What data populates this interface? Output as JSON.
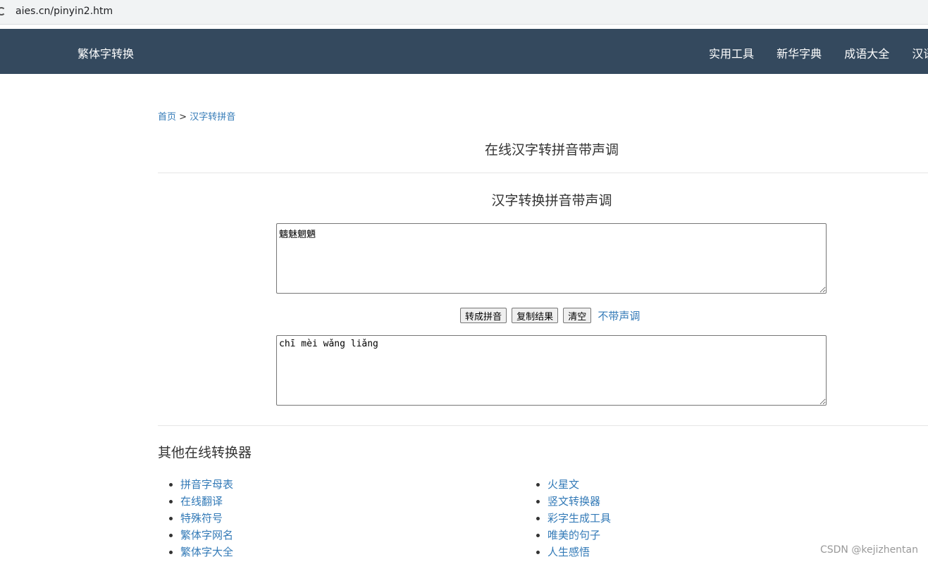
{
  "browser": {
    "url": "aies.cn/pinyin2.htm"
  },
  "navbar": {
    "brand": "繁体字转换",
    "links": [
      "实用工具",
      "新华字典",
      "成语大全",
      "汉语"
    ]
  },
  "breadcrumb": {
    "home": "首页",
    "separator": ">",
    "current": "汉字转拼音"
  },
  "page_title": "在线汉字转拼音带声调",
  "section_title": "汉字转换拼音带声调",
  "input": {
    "value": "魑魅魍魉"
  },
  "buttons": {
    "convert": "转成拼音",
    "copy": "复制结果",
    "clear": "清空"
  },
  "tone_link": "不带声调",
  "output": {
    "value": "chī mèi wǎng liǎng"
  },
  "other": {
    "title": "其他在线转换器",
    "left": [
      "拼音字母表",
      "在线翻译",
      "特殊符号",
      "繁体字网名",
      "繁体字大全"
    ],
    "right": [
      "火星文",
      "竖文转换器",
      "彩字生成工具",
      "唯美的句子",
      "人生感悟"
    ]
  },
  "watermark": "CSDN @kejizhentan"
}
